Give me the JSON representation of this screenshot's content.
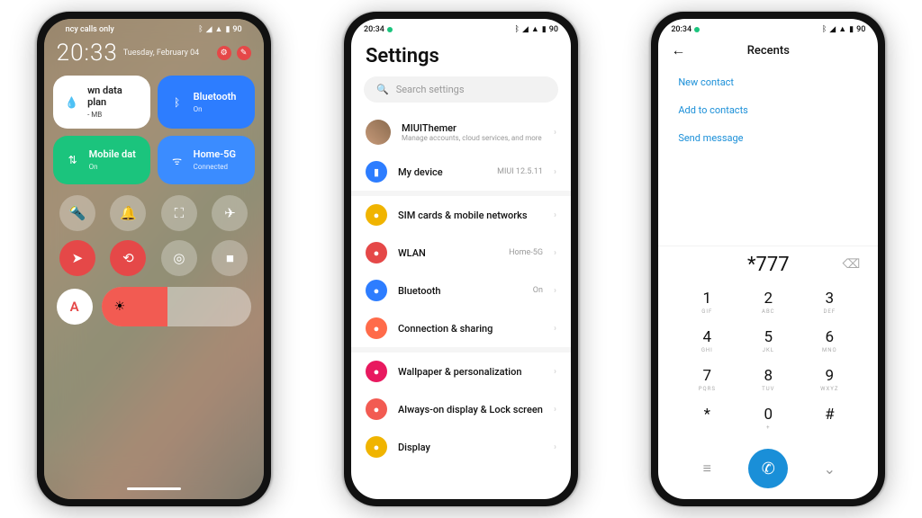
{
  "status": {
    "time": "20:34",
    "carrier": "ncy calls only",
    "battery": "90"
  },
  "p1": {
    "clock": "20:33",
    "date": "Tuesday, February 04",
    "tiles": {
      "data": {
        "label": "wn data plan",
        "sub": "- MB"
      },
      "bt": {
        "label": "Bluetooth",
        "sub": "On"
      },
      "mob": {
        "label": "Mobile dat",
        "sub": "On"
      },
      "wifi": {
        "label": "Home-5G",
        "sub": "Connected"
      }
    },
    "auto_label": "A"
  },
  "p2": {
    "title": "Settings",
    "search_ph": "Search settings",
    "account": {
      "name": "MIUIThemer",
      "sub": "Manage accounts, cloud services, and more"
    },
    "device": {
      "label": "My device",
      "val": "MIUI 12.5.11"
    },
    "items": [
      {
        "label": "SIM cards & mobile networks",
        "val": "",
        "color": "#f0b400"
      },
      {
        "label": "WLAN",
        "val": "Home-5G",
        "color": "#e54848"
      },
      {
        "label": "Bluetooth",
        "val": "On",
        "color": "#2d7dff"
      },
      {
        "label": "Connection & sharing",
        "val": "",
        "color": "#ff6b4a"
      }
    ],
    "items2": [
      {
        "label": "Wallpaper & personalization",
        "color": "#e8195f"
      },
      {
        "label": "Always-on display & Lock screen",
        "color": "#f25b52"
      },
      {
        "label": "Display",
        "color": "#f0b400"
      }
    ]
  },
  "p3": {
    "title": "Recents",
    "links": [
      "New contact",
      "Add to contacts",
      "Send message"
    ],
    "number": "*777",
    "keys": [
      {
        "d": "1",
        "l": "GIF"
      },
      {
        "d": "2",
        "l": "ABC"
      },
      {
        "d": "3",
        "l": "DEF"
      },
      {
        "d": "4",
        "l": "GHI"
      },
      {
        "d": "5",
        "l": "JKL"
      },
      {
        "d": "6",
        "l": "MNO"
      },
      {
        "d": "7",
        "l": "PQRS"
      },
      {
        "d": "8",
        "l": "TUV"
      },
      {
        "d": "9",
        "l": "WXYZ"
      },
      {
        "d": "*",
        "l": ""
      },
      {
        "d": "0",
        "l": "+"
      },
      {
        "d": "#",
        "l": ""
      }
    ]
  }
}
